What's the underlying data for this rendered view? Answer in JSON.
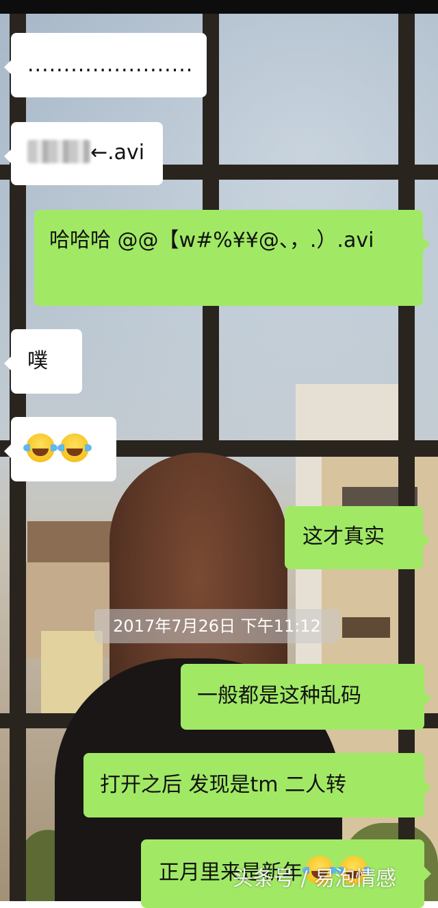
{
  "messages": [
    {
      "direction": "received",
      "text": "......................."
    },
    {
      "direction": "received",
      "text": "←.avi"
    },
    {
      "direction": "sent",
      "text": "哈哈哈 @@【w#%¥¥@、，.）.avi"
    },
    {
      "direction": "received",
      "text": "噗"
    },
    {
      "direction": "received",
      "emoji": [
        "tears-of-joy",
        "tears-of-joy"
      ]
    },
    {
      "direction": "sent",
      "text": "这才真实"
    },
    {
      "direction": "sent",
      "text": "一般都是这种乱码"
    },
    {
      "direction": "sent",
      "text": "打开之后 发现是tm 二人转"
    },
    {
      "direction": "sent",
      "text": "正月里来是新年",
      "emoji": [
        "tears-of-joy",
        "tears-of-joy"
      ]
    }
  ],
  "timestamp": "2017年7月26日 下午11:12",
  "watermark": "头条号 / 易泡情感",
  "colors": {
    "sent_bubble": "#a1e965",
    "received_bubble": "#ffffff"
  }
}
